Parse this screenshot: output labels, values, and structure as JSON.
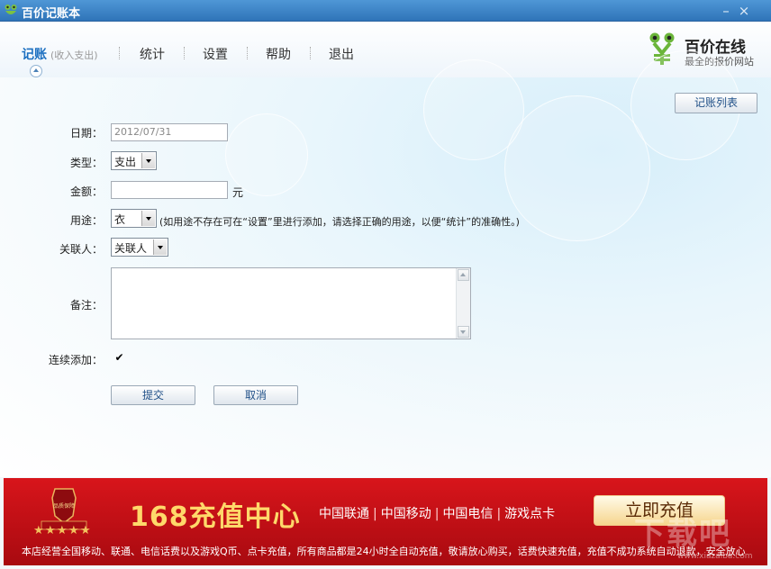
{
  "window": {
    "title": "百价记账本",
    "minimize_glyph": "–",
    "close_glyph": "×"
  },
  "nav": {
    "active_label": "记账",
    "active_sub": "(收入支出)",
    "items": [
      "统计",
      "设置",
      "帮助",
      "退出"
    ]
  },
  "brand": {
    "name": "百价在线",
    "slogan": "最全的报价网站",
    "icon": "frog-yen-logo-icon"
  },
  "toolbar": {
    "list_button": "记账列表"
  },
  "form": {
    "date_label": "日期：",
    "date_value": "2012/07/31",
    "type_label": "类型：",
    "type_value": "支出",
    "amount_label": "金额：",
    "amount_value": "",
    "amount_unit": "元",
    "purpose_label": "用途：",
    "purpose_value": "衣",
    "purpose_hint": "(如用途不存在可在“设置”里进行添加，请选择正确的用途，以便“统计”的准确性。)",
    "contact_label": "关联人：",
    "contact_value": "关联人",
    "note_label": "备注：",
    "note_value": "",
    "continuous_label": "连续添加：",
    "continuous_checked": true,
    "submit_label": "提交",
    "cancel_label": "取消"
  },
  "banner": {
    "badge_text": "品质保障",
    "title": "168充值中心",
    "carriers": [
      "中国联通",
      "中国移动",
      "中国电信",
      "游戏点卡"
    ],
    "cta": "立即充值",
    "footer": "本店经营全国移动、联通、电信话费以及游戏Q币、点卡充值，所有商品都是24小时全自动充值，敬请放心购买，话费快速充值，充值不成功系统自动退款，安全放心",
    "watermark": "下载吧",
    "watermark_url": "www.xiazaiba.com"
  },
  "colors": {
    "titlebar": "#3a82c6",
    "accent": "#1b6fc0",
    "banner_red": "#c8121a",
    "banner_gold": "#ffd86a"
  }
}
